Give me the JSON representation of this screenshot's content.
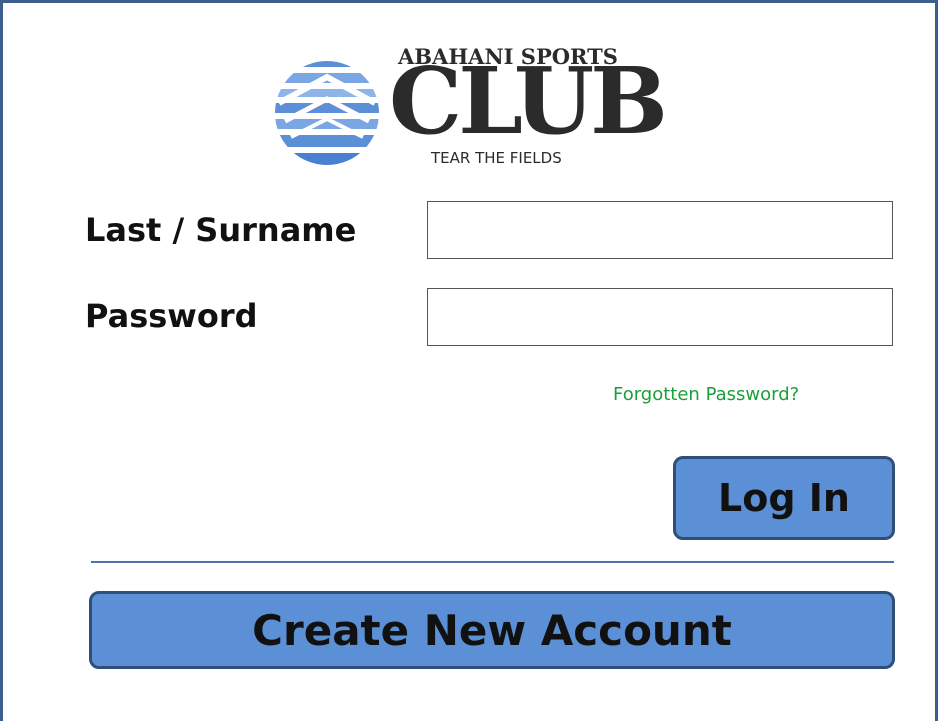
{
  "brand": {
    "top": "ABAHANI SPORTS",
    "club": "CLUB",
    "tagline": "TEAR THE FIELDS",
    "logo_icon": "striped-globe-logo",
    "colors": {
      "logo_blue": "#5b8fd6",
      "text": "#2b2b2b"
    }
  },
  "form": {
    "last_label": "Last / Surname",
    "last_value": "",
    "password_label": "Password",
    "password_value": "",
    "forgot_link": "Forgotten Password?",
    "login_button": "Log In",
    "create_button": "Create New Account"
  },
  "colors": {
    "button": "#5b8fd6",
    "button_border": "#2f4f78",
    "link": "#1a9f3a",
    "divider": "#4a73a8",
    "frame": "#3b5f8f"
  }
}
